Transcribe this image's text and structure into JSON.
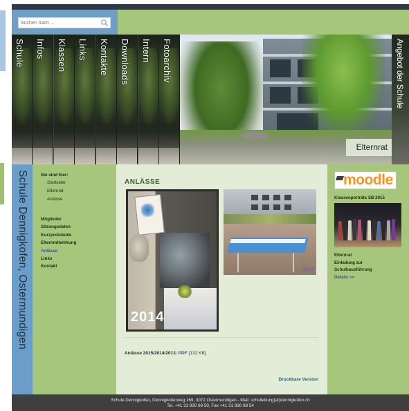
{
  "search": {
    "placeholder": "Suchen nach ..."
  },
  "nav": {
    "tabs": [
      {
        "label": "Schule"
      },
      {
        "label": "Infos"
      },
      {
        "label": "Klassen"
      },
      {
        "label": "Links"
      },
      {
        "label": "Kontakte"
      },
      {
        "label": "Downloads"
      },
      {
        "label": "Intern"
      },
      {
        "label": "Fotoarchiv"
      }
    ],
    "angebot": "Angebot der Schule"
  },
  "header": {
    "section_label": "Elternrat"
  },
  "side_title": "Schule Dennigkofen, Ostermundigen",
  "breadcrumb": {
    "heading": "Sie sind hier:",
    "items": [
      "Startseite",
      "Elternrat",
      "Anlässe"
    ]
  },
  "subnav": {
    "items": [
      {
        "label": "Mitglieder",
        "active": false
      },
      {
        "label": "Sitzungsdaten",
        "active": false
      },
      {
        "label": "Kurzprotokolle",
        "active": false
      },
      {
        "label": "Elternmitwirkung",
        "active": false
      },
      {
        "label": "Anlässe",
        "active": true
      },
      {
        "label": "Links",
        "active": false
      },
      {
        "label": "Kontakt",
        "active": false
      }
    ]
  },
  "main": {
    "title": "ANLÄSSE",
    "photo1_year": "2014",
    "photo2_stamp": "2014",
    "download_label": "Anlässe 2015/2014/2013:",
    "download_link": "PDF",
    "download_size": "[132 KB]",
    "print_link": "Druckbare Version"
  },
  "right": {
    "moodle_word": "moodle",
    "class_heading": "Klassenporträts SB 2015",
    "elternrat_heading": "Elternrat",
    "invite_line1": "Einladung zur",
    "invite_line2": "Schulhausführung",
    "details_link": "Details »»"
  },
  "footer": {
    "line1": "Schule Dennigkofen, Dennigkofenweg 169, 3072 Ostermundigen - Mail: schulleitung(at)dennigkofen.ch",
    "line2": "Tel. +41 31 930 88 50, Fax +41 31 930 88 54"
  },
  "colors": {
    "green": "#a6c77b",
    "blue": "#6a9dc7",
    "content_bg": "#e3ecd6",
    "link": "#2d5a84",
    "footer": "#3f3f3f",
    "moodle_orange": "#f7931e"
  },
  "icons": {
    "search": "search-icon"
  }
}
